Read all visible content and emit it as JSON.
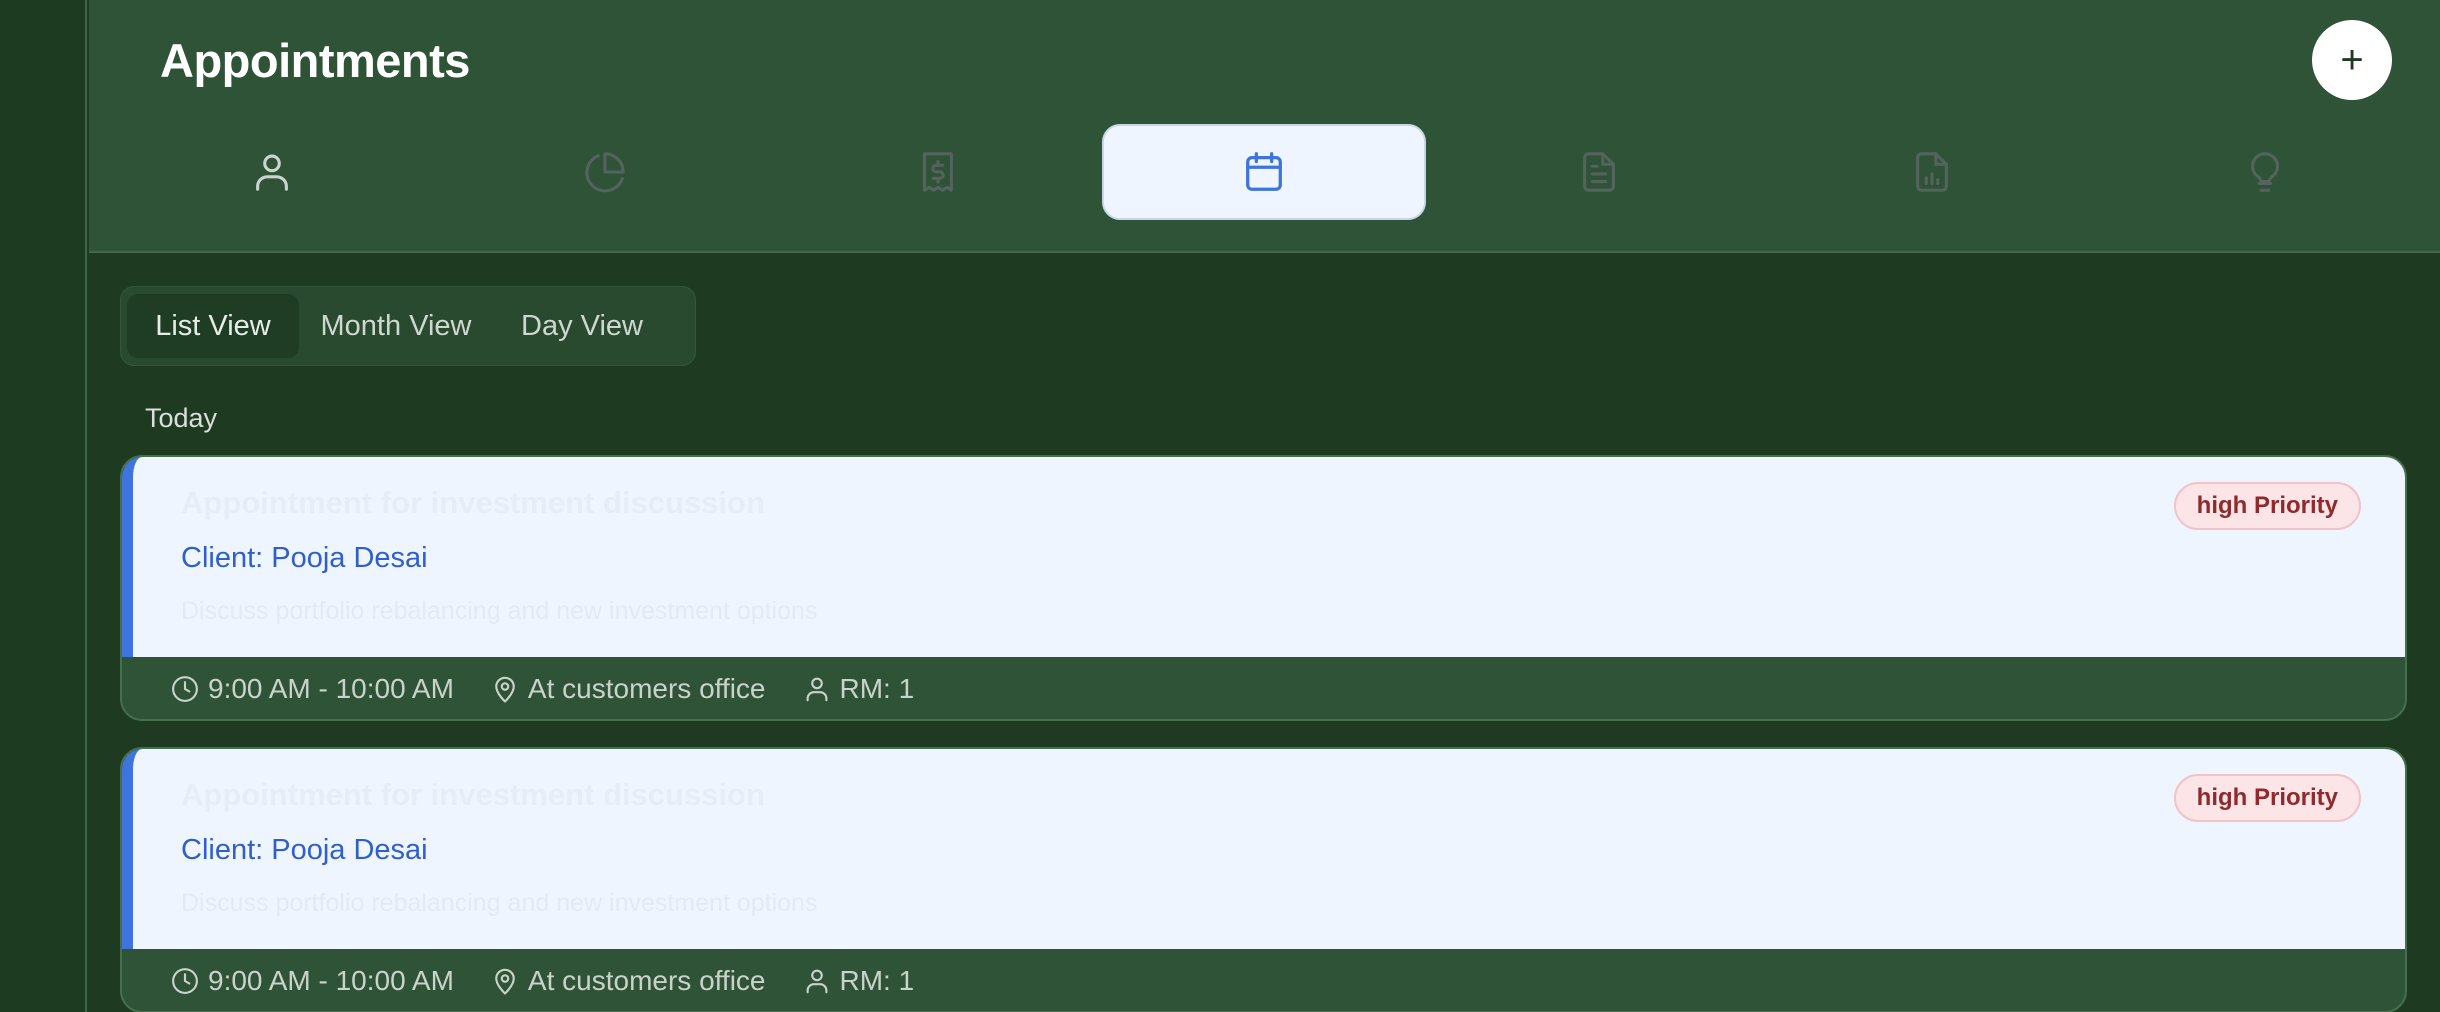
{
  "header": {
    "title": "Appointments",
    "add_label": "+"
  },
  "tabs": [
    {
      "icon": "user-icon",
      "active": false
    },
    {
      "icon": "pie-chart-icon",
      "active": false
    },
    {
      "icon": "receipt-dollar-icon",
      "active": false
    },
    {
      "icon": "calendar-icon",
      "active": true
    },
    {
      "icon": "document-icon",
      "active": false
    },
    {
      "icon": "report-chart-icon",
      "active": false
    },
    {
      "icon": "lightbulb-icon",
      "active": false
    }
  ],
  "view_toggle": {
    "list": "List View",
    "month": "Month View",
    "day": "Day View",
    "active": "List View"
  },
  "section": {
    "today": "Today"
  },
  "appointments": [
    {
      "title": "Appointment for investment discussion",
      "client": "Client: Pooja Desai",
      "description": "Discuss portfolio rebalancing and new investment options",
      "priority": "high Priority",
      "time": "9:00 AM - 10:00 AM",
      "location": "At customers office",
      "rm": "RM: 1"
    },
    {
      "title": "Appointment for investment discussion",
      "client": "Client: Pooja Desai",
      "description": "Discuss portfolio rebalancing and new investment options",
      "priority": "high Priority",
      "time": "9:00 AM - 10:00 AM",
      "location": "At customers office",
      "rm": "RM: 1"
    }
  ],
  "colors": {
    "accent": "#3f73dd",
    "header_bg": "#2f5336",
    "page_bg": "#1e3b22",
    "priority_text": "#8e2b2f",
    "priority_bg": "#fbe5e7"
  }
}
